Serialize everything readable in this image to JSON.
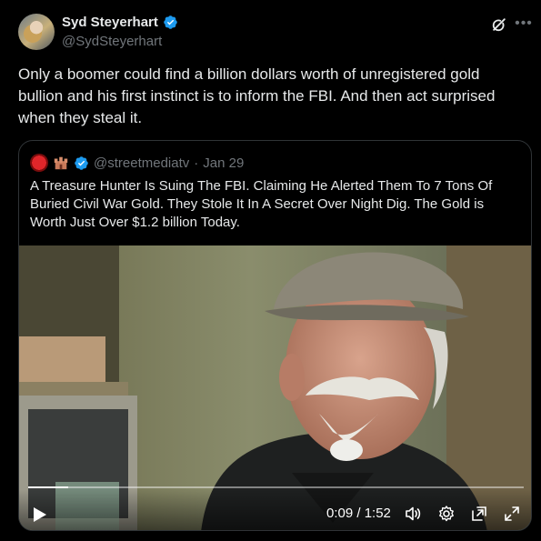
{
  "author": {
    "name": "Syd Steyerhart",
    "handle": "@SydSteyerhart",
    "verified": true
  },
  "post": {
    "text": "Only a boomer could find a billion dollars worth of unregistered gold bullion and his first instinct is to inform the FBI. And then act surprised when they steal it."
  },
  "quoted": {
    "handle": "@streetmediatv",
    "separator": "·",
    "date": "Jan 29",
    "text": "A Treasure Hunter Is Suing The FBI. Claiming He Alerted Them To 7 Tons Of Buried Civil War Gold. They Stole It In A Secret Over Night Dig. The Gold is Worth Just Over $1.2 billion Today."
  },
  "video": {
    "time": "0:09 / 1:52",
    "progress_fraction": 0.08
  },
  "icons": {
    "verified": "verified-badge-icon",
    "grok": "grok-icon",
    "more": "more-options-icon",
    "play": "play-icon",
    "volume": "volume-icon",
    "settings": "settings-gear-icon",
    "pip": "picture-in-picture-icon",
    "fullscreen": "fullscreen-icon"
  },
  "colors": {
    "background": "#000000",
    "text": "#e7e9ea",
    "secondary_text": "#71767b",
    "verified_blue": "#1d9bf0",
    "border": "#2f3336"
  }
}
